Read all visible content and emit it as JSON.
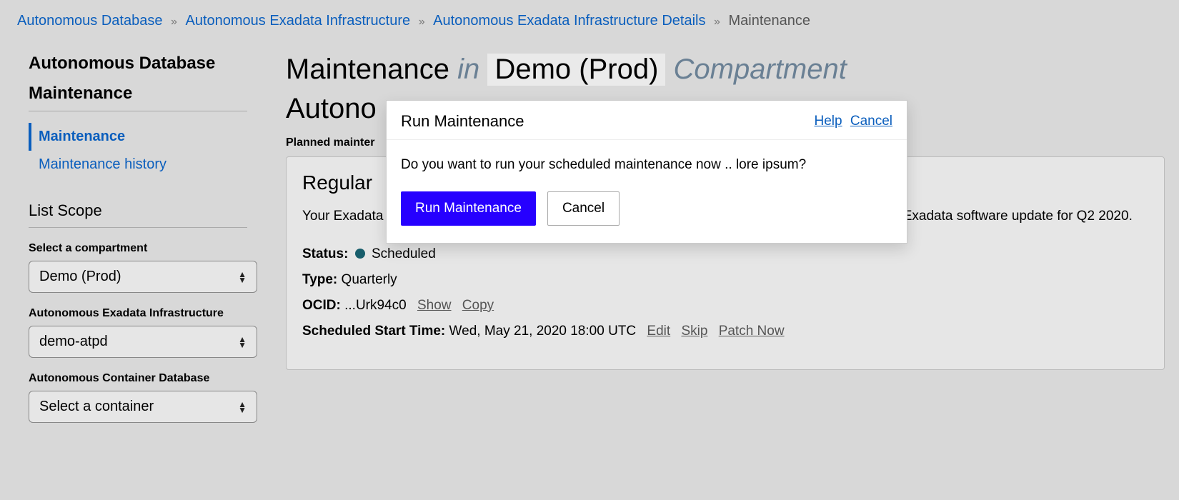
{
  "breadcrumb": {
    "items": [
      "Autonomous Database",
      "Autonomous Exadata Infrastructure",
      "Autonomous Exadata Infrastructure Details"
    ],
    "current": "Maintenance",
    "sep": "»"
  },
  "sidebar": {
    "title1": "Autonomous Database",
    "title2": "Maintenance",
    "nav": [
      {
        "label": "Maintenance",
        "active": true
      },
      {
        "label": "Maintenance history",
        "active": false
      }
    ],
    "scope_title": "List Scope",
    "compartment": {
      "label": "Select a compartment",
      "value": "Demo (Prod)"
    },
    "infra": {
      "label": "Autonomous Exadata Infrastructure",
      "value": "demo-atpd"
    },
    "container": {
      "label": "Autonomous Container Database",
      "value": "Select a container"
    }
  },
  "main": {
    "title_prefix": "Maintenance",
    "title_in": "in",
    "title_env": "Demo (Prod)",
    "title_suffix": "Compartment",
    "subtitle_partial": "Autono",
    "planned_label": "Planned mainter",
    "panel": {
      "heading": "Regular",
      "desc": "Your Exadata infrastructure is scheduled for maintenance at 2020-06-07T04:00. The patch contains Exadata software update for Q2 2020.",
      "status_label": "Status:",
      "status_value": "Scheduled",
      "type_label": "Type:",
      "type_value": "Quarterly",
      "ocid_label": "OCID:",
      "ocid_value": "...Urk94c0",
      "ocid_show": "Show",
      "ocid_copy": "Copy",
      "sched_label": "Scheduled Start Time:",
      "sched_value": "Wed, May 21, 2020 18:00 UTC",
      "sched_edit": "Edit",
      "sched_skip": "Skip",
      "sched_patch": "Patch Now"
    }
  },
  "dialog": {
    "title": "Run Maintenance",
    "help": "Help",
    "cancel_link": "Cancel",
    "body": "Do you want to run your scheduled maintenance now .. lore ipsum?",
    "primary": "Run Maintenance",
    "secondary": "Cancel"
  }
}
